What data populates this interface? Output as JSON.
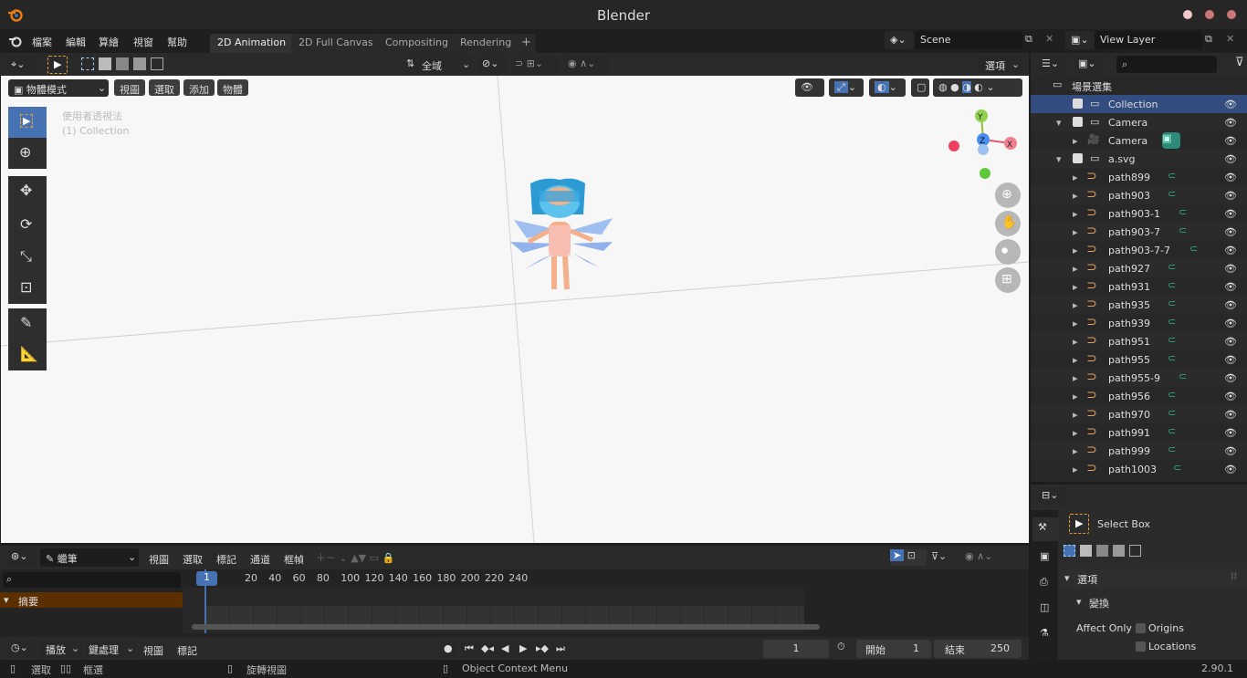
{
  "window": {
    "title": "Blender",
    "icon": "blender-logo-icon"
  },
  "menu": [
    "檔案",
    "編輯",
    "算繪",
    "視窗",
    "幫助"
  ],
  "workspace_tabs": [
    {
      "label": "2D Animation",
      "active": true
    },
    {
      "label": "2D Full Canvas",
      "active": false
    },
    {
      "label": "Compositing",
      "active": false
    },
    {
      "label": "Rendering",
      "active": false
    }
  ],
  "scene": {
    "label": "Scene",
    "view_layer": "View Layer"
  },
  "viewport_header": {
    "mode": "物體模式",
    "menus": [
      "視圖",
      "選取",
      "添加",
      "物體"
    ],
    "transform_orientation": "全域",
    "options": "選項"
  },
  "viewport": {
    "overlay_line1": "使用者透視法",
    "overlay_line2": "(1) Collection",
    "gizmo": {
      "x": "X",
      "y": "Y",
      "z": "Z"
    }
  },
  "outliner": {
    "header": "場景選集",
    "rows": [
      {
        "label": "Collection",
        "selected": true
      },
      {
        "label": "Camera"
      },
      {
        "label": "Camera"
      },
      {
        "label": "a.svg"
      },
      {
        "label": "path899"
      },
      {
        "label": "path903"
      },
      {
        "label": "path903-1"
      },
      {
        "label": "path903-7"
      },
      {
        "label": "path903-7-7"
      },
      {
        "label": "path927"
      },
      {
        "label": "path931"
      },
      {
        "label": "path935"
      },
      {
        "label": "path939"
      },
      {
        "label": "path951"
      },
      {
        "label": "path955"
      },
      {
        "label": "path955-9"
      },
      {
        "label": "path956"
      },
      {
        "label": "path970"
      },
      {
        "label": "path991"
      },
      {
        "label": "path999"
      },
      {
        "label": "path1003"
      }
    ]
  },
  "properties": {
    "tool_name": "Select Box",
    "section": "選項",
    "subsection": "變換",
    "affect_only": "Affect Only",
    "origins": "Origins",
    "locations": "Locations"
  },
  "timeline": {
    "brush": "蠟筆",
    "menus": [
      "視圖",
      "選取",
      "標記",
      "通道",
      "框幀"
    ],
    "summary": "摘要",
    "current_frame": "1",
    "ticks": [
      "20",
      "40",
      "60",
      "80",
      "100",
      "120",
      "140",
      "160",
      "180",
      "200",
      "220",
      "240"
    ]
  },
  "playback": {
    "menus": [
      "播放",
      "鍵處理",
      "視圖",
      "標記"
    ],
    "frame": "1",
    "start_label": "開始",
    "start": "1",
    "end_label": "結束",
    "end": "250"
  },
  "statusbar": {
    "select": "選取",
    "box": "框選",
    "rotate": "旋轉視圖",
    "context": "Object Context Menu",
    "version": "2.90.1"
  },
  "colors": {
    "accent": "#4772b3",
    "curve_icon": "#e5a060",
    "path_data": "#2fb58a"
  }
}
